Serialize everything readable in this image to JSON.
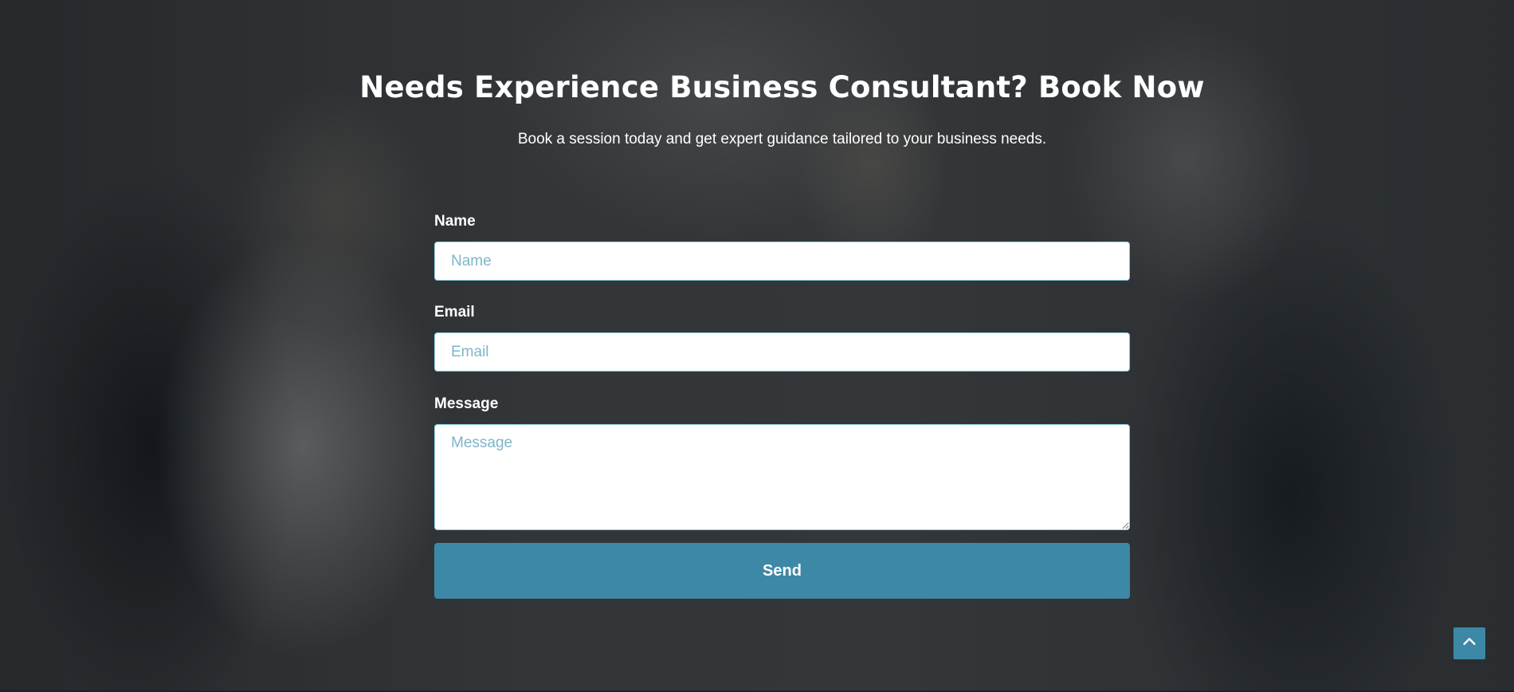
{
  "hero": {
    "title": "Needs Experience Business Consultant? Book Now",
    "subtitle": "Book a session today and get expert guidance tailored to your business needs."
  },
  "form": {
    "name": {
      "label": "Name",
      "placeholder": "Name",
      "value": ""
    },
    "email": {
      "label": "Email",
      "placeholder": "Email",
      "value": ""
    },
    "message": {
      "label": "Message",
      "placeholder": "Message",
      "value": ""
    },
    "send_label": "Send"
  },
  "back_to_top": {
    "icon": "chevron-up-icon"
  },
  "colors": {
    "accent": "#3d88a6",
    "input_border": "#8fd0e0",
    "placeholder": "#7eb5c9",
    "text": "#ffffff"
  }
}
